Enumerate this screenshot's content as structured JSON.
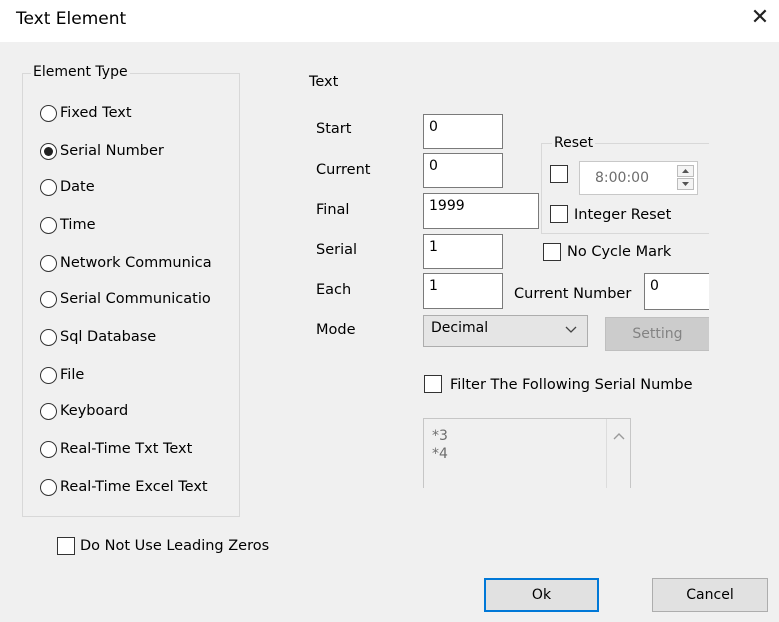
{
  "window": {
    "title": "Text Element",
    "close_glyph": "✕"
  },
  "element_type": {
    "legend": "Element Type",
    "options": [
      {
        "label": "Fixed Text",
        "checked": false
      },
      {
        "label": "Serial Number",
        "checked": true
      },
      {
        "label": "Date",
        "checked": false
      },
      {
        "label": "Time",
        "checked": false
      },
      {
        "label": "Network Communica",
        "checked": false
      },
      {
        "label": "Serial Communicatio",
        "checked": false
      },
      {
        "label": "Sql Database",
        "checked": false
      },
      {
        "label": "File",
        "checked": false
      },
      {
        "label": "Keyboard",
        "checked": false
      },
      {
        "label": "Real-Time Txt Text",
        "checked": false
      },
      {
        "label": "Real-Time Excel Text",
        "checked": false
      }
    ]
  },
  "leading_zeros": {
    "label": "Do Not Use Leading Zeros",
    "checked": false
  },
  "text_panel": {
    "heading": "Text",
    "start_label": "Start",
    "start_value": "0",
    "current_label": "Current",
    "current_value": "0",
    "final_label": "Final",
    "final_value": "1999",
    "serial_label": "Serial",
    "serial_value": "1",
    "each_label": "Each",
    "each_value": "1",
    "mode_label": "Mode",
    "mode_value": "Decimal",
    "reset_legend": "Reset",
    "reset_time": "8:00:00",
    "integer_reset_label": "Integer Reset",
    "no_cycle_label": "No Cycle Mark",
    "current_number_label": "Current Number",
    "current_number_value": "0",
    "setting_label": "Setting",
    "filter_label": "Filter The Following Serial Numbe",
    "filter_items": [
      "*3",
      "*4"
    ]
  },
  "buttons": {
    "ok": "Ok",
    "cancel": "Cancel"
  },
  "icons": {
    "dropdown": "chevron-down-icon",
    "spin_up": "triangle-up-icon",
    "spin_down": "triangle-down-icon",
    "scroll_up": "chevron-up-icon"
  }
}
